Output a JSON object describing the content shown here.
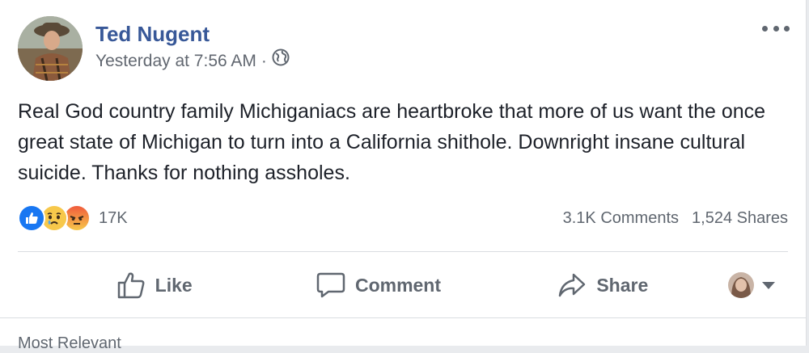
{
  "post": {
    "author": "Ted Nugent",
    "timestamp": "Yesterday at 7:56 AM",
    "separator": "·",
    "privacy_icon": "globe-icon",
    "text": "Real God country family Michiganiacs are heartbroke that more of us want the once great state of Michigan to turn into a California shithole. Downright insane cultural suicide. Thanks for nothing assholes."
  },
  "stats": {
    "reactions": [
      "like",
      "sad",
      "angry"
    ],
    "reaction_count": "17K",
    "comments": "3.1K Comments",
    "shares": "1,524 Shares"
  },
  "actions": {
    "like": "Like",
    "comment": "Comment",
    "share": "Share"
  },
  "comments": {
    "sort_label": "Most Relevant"
  },
  "colors": {
    "author": "#385898",
    "like_blue": "#1877f2",
    "muted": "#606770",
    "text": "#1d2129"
  }
}
